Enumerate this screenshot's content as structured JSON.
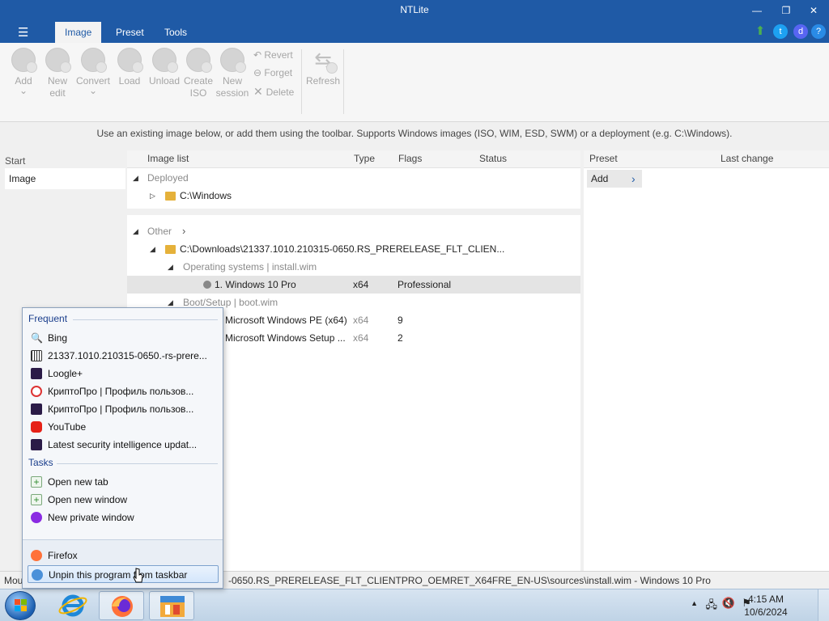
{
  "window": {
    "title": "NTLite"
  },
  "tabs": [
    "Image",
    "Preset",
    "Tools"
  ],
  "ribbon": {
    "buttons": [
      {
        "label": "Add",
        "sub": "⌄"
      },
      {
        "label": "New\nedit"
      },
      {
        "label": "Convert",
        "sub": "⌄"
      },
      {
        "label": "Load"
      },
      {
        "label": "Unload"
      },
      {
        "label": "Create\nISO"
      },
      {
        "label": "New\nsession"
      }
    ],
    "small": [
      "Revert",
      "Forget",
      "Delete"
    ],
    "refresh": "Refresh"
  },
  "info": "Use an existing image below, or add them using the toolbar. Supports Windows images (ISO, WIM, ESD, SWM) or a deployment (e.g. C:\\Windows).",
  "left": {
    "header": "Start",
    "item": "Image"
  },
  "table": {
    "columns": [
      "Image list",
      "Type",
      "Flags",
      "Status"
    ],
    "deployed_label": "Deployed",
    "deployed_item": "C:\\Windows",
    "other_label": "Other",
    "source_path": "C:\\Downloads\\21337.1010.210315-0650.RS_PRERELEASE_FLT_CLIEN...",
    "os_group": "Operating systems  |  install.wim",
    "os_item": {
      "name": "1. Windows 10 Pro",
      "type": "x64",
      "flags": "Professional"
    },
    "boot_group": "Boot/Setup  |  boot.wim",
    "boot_items": [
      {
        "name": "Microsoft Windows PE (x64)",
        "type": "x64",
        "flags": "9"
      },
      {
        "name": "Microsoft Windows Setup ...",
        "type": "x64",
        "flags": "2"
      }
    ]
  },
  "preset": {
    "columns": [
      "Preset",
      "Last change"
    ],
    "add": "Add"
  },
  "statusbar": {
    "prefix": "Mou",
    "text": "-0650.RS_PRERELEASE_FLT_CLIENTPRO_OEMRET_X64FRE_EN-US\\sources\\install.wim - Windows 10 Pro"
  },
  "jumplist": {
    "frequent_header": "Frequent",
    "frequent": [
      {
        "label": "Bing",
        "icon": "search-icon"
      },
      {
        "label": "21337.1010.210315-0650.-rs-prere...",
        "icon": "archive-icon"
      },
      {
        "label": "Loogle+",
        "icon": "page-icon"
      },
      {
        "label": "КриптоПро | Профиль пользов...",
        "icon": "refresh-icon"
      },
      {
        "label": "КриптоПро | Профиль пользов...",
        "icon": "page-icon"
      },
      {
        "label": "YouTube",
        "icon": "youtube-icon"
      },
      {
        "label": "Latest security intelligence updat...",
        "icon": "page-icon"
      }
    ],
    "tasks_header": "Tasks",
    "tasks": [
      {
        "label": "Open new tab",
        "icon": "new-tab-icon"
      },
      {
        "label": "Open new window",
        "icon": "new-window-icon"
      },
      {
        "label": "New private window",
        "icon": "private-window-icon"
      }
    ],
    "app": "Firefox",
    "unpin": "Unpin this program from taskbar"
  },
  "taskbar": {
    "time": "4:15 AM",
    "date": "10/6/2024"
  }
}
